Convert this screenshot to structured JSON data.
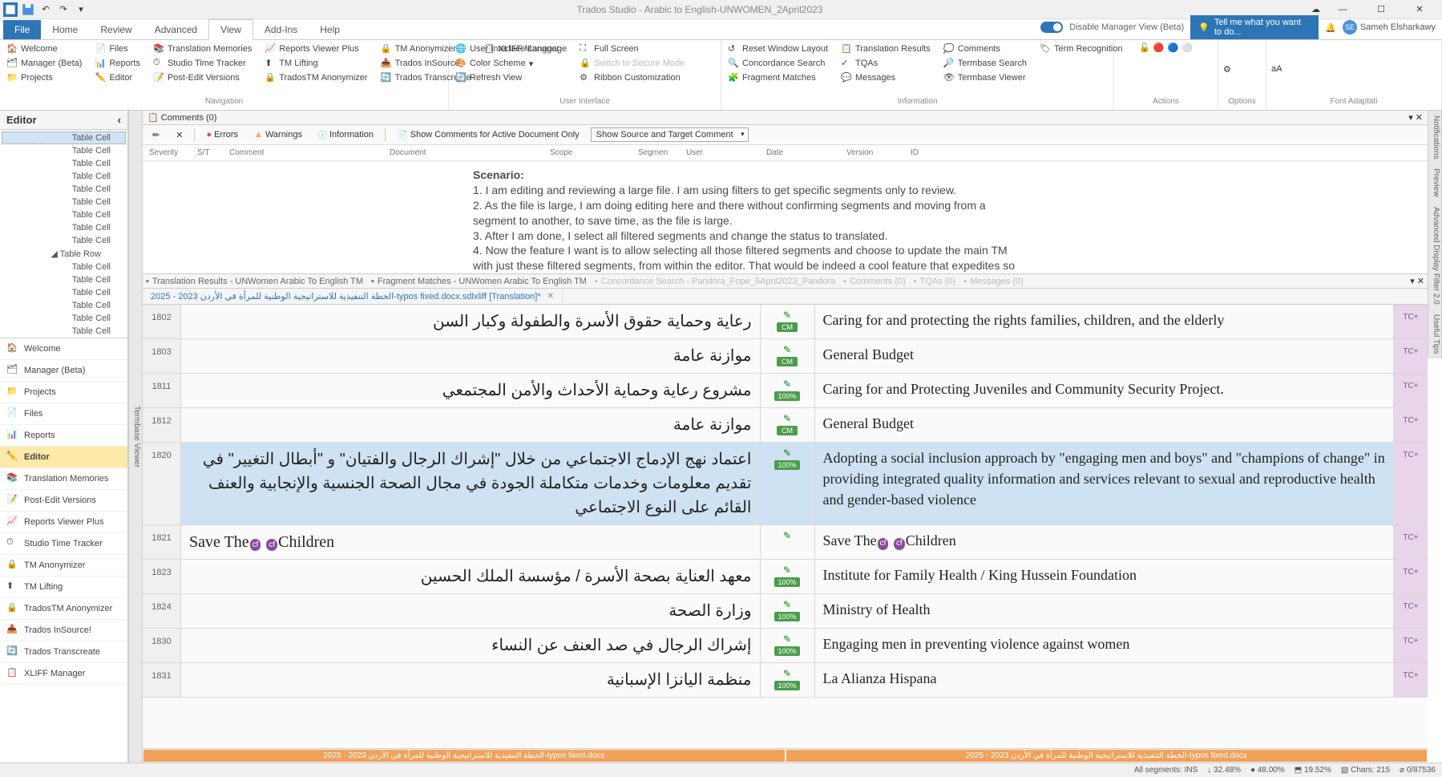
{
  "titlebar": {
    "title": "Trados Studio - Arabic to English-UNWOMEN_2April2023",
    "user_initials": "SE",
    "user_name": "Sameh Elsharkawy"
  },
  "ribbon": {
    "tabs": [
      "File",
      "Home",
      "Review",
      "Advanced",
      "View",
      "Add-Ins",
      "Help"
    ],
    "active_tab": "View",
    "disable_manager_view": "Disable Manager View (Beta)",
    "tell_me": "Tell me what you want to do...",
    "groups": {
      "navigation": {
        "label": "Navigation",
        "items": [
          "Welcome",
          "Manager (Beta)",
          "Projects",
          "Files",
          "Reports",
          "Editor",
          "Translation Memories",
          "Studio Time Tracker",
          "Post-Edit Versions",
          "Reports Viewer Plus",
          "TM Lifting",
          "TradosTM Anonymizer",
          "TM Anonymizer",
          "Trados InSource!",
          "Trados Transcreate",
          "XLIFF Manager"
        ]
      },
      "user_interface": {
        "label": "User Interface",
        "items": [
          "User Interface Language",
          "Color Scheme",
          "Refresh View",
          "Full Screen",
          "Switch to Secure Mode",
          "Ribbon Customization"
        ]
      },
      "information": {
        "label": "Information",
        "items": [
          "Reset Window Layout",
          "Concordance Search",
          "Fragment Matches",
          "Translation Results",
          "TQAs",
          "Messages",
          "Comments",
          "Termbase Search",
          "Termbase Viewer",
          "Term Recognition"
        ]
      },
      "actions": {
        "label": "Actions"
      },
      "options": {
        "label": "Options"
      },
      "font_adapt": {
        "label": "Font Adaptati"
      }
    }
  },
  "editor_panel_title": "Editor",
  "tree": {
    "items": [
      "Table Cell",
      "Table Cell",
      "Table Cell",
      "Table Cell",
      "Table Cell",
      "Table Cell",
      "Table Cell",
      "Table Cell",
      "Table Cell",
      "Table Row",
      "Table Cell",
      "Table Cell",
      "Table Cell",
      "Table Cell",
      "Table Cell",
      "Table Cell"
    ],
    "selected_index": 0,
    "row_index": 9
  },
  "nav_items": [
    "Welcome",
    "Manager (Beta)",
    "Projects",
    "Files",
    "Reports",
    "Editor",
    "Translation Memories",
    "Post-Edit Versions",
    "Reports Viewer Plus",
    "Studio Time Tracker",
    "TM Anonymizer",
    "TM Lifting",
    "TradosTM Anonymizer",
    "Trados InSource!",
    "Trados Transcreate",
    "XLIFF Manager"
  ],
  "nav_active": "Editor",
  "left_vtab": "Termbase Viewer",
  "right_vtabs": [
    "Notifications",
    "Preview",
    "Advanced Display Filter 2.0",
    "Useful Tips"
  ],
  "comments": {
    "title": "Comments (0)",
    "toolbar": {
      "errors": "Errors",
      "warnings": "Warnings",
      "information": "Information",
      "active_doc": "Show Comments for Active Document Only",
      "dropdown": "Show Source and Target Comment"
    },
    "columns": [
      "Severity",
      "S/T",
      "Comment",
      "Document",
      "Scope",
      "Segmen",
      "User",
      "Date",
      "Version",
      "ID"
    ]
  },
  "scenario": {
    "title": "Scenario:",
    "l1": "1. I am editing and reviewing a large file. I am using filters to get specific segments only to review.",
    "l2": "2. As the file is large, I am doing editing here and there without confirming segments and moving from a segment to another, to save time, as the file is large.",
    "l3": "3. After I am done, I select all filtered segments and change the status to translated.",
    "l4": "4. Now the feature I want is to allow selecting all those filtered segments and choose to update the main TM with just these filtered segments, from within the editor. That would be indeed a cool feature that expedites so many revision processes."
  },
  "subtabs": [
    {
      "label": "Translation Results - UNWomen Arabic To English TM",
      "disabled": false
    },
    {
      "label": "Fragment Matches - UNWomen Arabic To English TM",
      "disabled": false
    },
    {
      "label": "Concordance Search - Pandora_Fope_5April2023_Pandora",
      "disabled": true
    },
    {
      "label": "Comments (0)",
      "disabled": true
    },
    {
      "label": "TQAs (0)",
      "disabled": true
    },
    {
      "label": "Messages (0)",
      "disabled": true
    }
  ],
  "file_tab": "الخطة التنفيذية للاستراتيجية الوطنية للمرأة في الأردن 2023 - 2025-typos fixed.docx.sdlxliff [Translation]*",
  "segments": [
    {
      "num": "1802",
      "src": "رعاية وحماية حقوق الأسرة والطفولة وكبار السن",
      "badge": "CM",
      "tgt": "Caring for and protecting the rights families, children, and the elderly",
      "tc": "TC+"
    },
    {
      "num": "1803",
      "src": "موازنة عامة",
      "badge": "CM",
      "tgt": "General Budget",
      "tc": "TC+"
    },
    {
      "num": "1811",
      "src": "مشروع رعاية وحماية الأحداث والأمن المجتمعي",
      "badge": "100%",
      "tgt": "Caring for and Protecting Juveniles and Community Security Project.",
      "tc": "TC+"
    },
    {
      "num": "1812",
      "src": "موازنة عامة",
      "badge": "CM",
      "tgt": "General Budget",
      "tc": "TC+"
    },
    {
      "num": "1820",
      "src": "اعتماد نهج الإدماج الاجتماعي من خلال \"إشراك الرجال والفتيان\" و \"أبطال التغيير\" في تقديم معلومات وخدمات متكاملة الجودة في مجال الصحة الجنسية والإنجابية والعنف القائم على النوع الاجتماعي",
      "badge": "100%",
      "tgt": "Adopting a social inclusion approach by \"engaging men and boys\" and \"champions of change\" in providing integrated quality information and services relevant to sexual and reproductive health and gender-based violence",
      "tc": "TC+",
      "active": true
    },
    {
      "num": "1821",
      "src": "Save The  Children",
      "badge": "",
      "tgt": "Save The  Children",
      "tc": "TC+",
      "cf": true
    },
    {
      "num": "1823",
      "src": "معهد العناية بصحة الأسرة / مؤسسة الملك الحسين",
      "badge": "100%",
      "tgt": "Institute for Family Health / King Hussein Foundation",
      "tc": "TC+"
    },
    {
      "num": "1824",
      "src": "وزارة الصحة",
      "badge": "100%",
      "tgt": "Ministry of Health",
      "tc": "TC+"
    },
    {
      "num": "1830",
      "src": "إشراك الرجال في صد العنف عن النساء",
      "badge": "100%",
      "tgt": "Engaging men in preventing violence against women",
      "tc": "TC+"
    },
    {
      "num": "1831",
      "src": "منظمة اليانزا الإسبانية",
      "badge": "100%",
      "tgt": "La Alianza Hispana",
      "tc": "TC+"
    }
  ],
  "bottom_strip": {
    "left": "الخطة التنفيذية للاستراتيجية الوطنية للمرأة في الأردن 2023 - 2025-typos fixed.docx",
    "right": "الخطة التنفيذية للاستراتيجية الوطنية للمرأة في الأردن 2023 - 2025-typos fixed.docx"
  },
  "statusbar": {
    "s1": "All segments: INS",
    "s2": "↓ 32.48%",
    "s3": "● 48.00%",
    "s4": "⬒ 19.52%",
    "s5": "▧ Chars: 215",
    "s6": "⌀ 0/87536"
  }
}
